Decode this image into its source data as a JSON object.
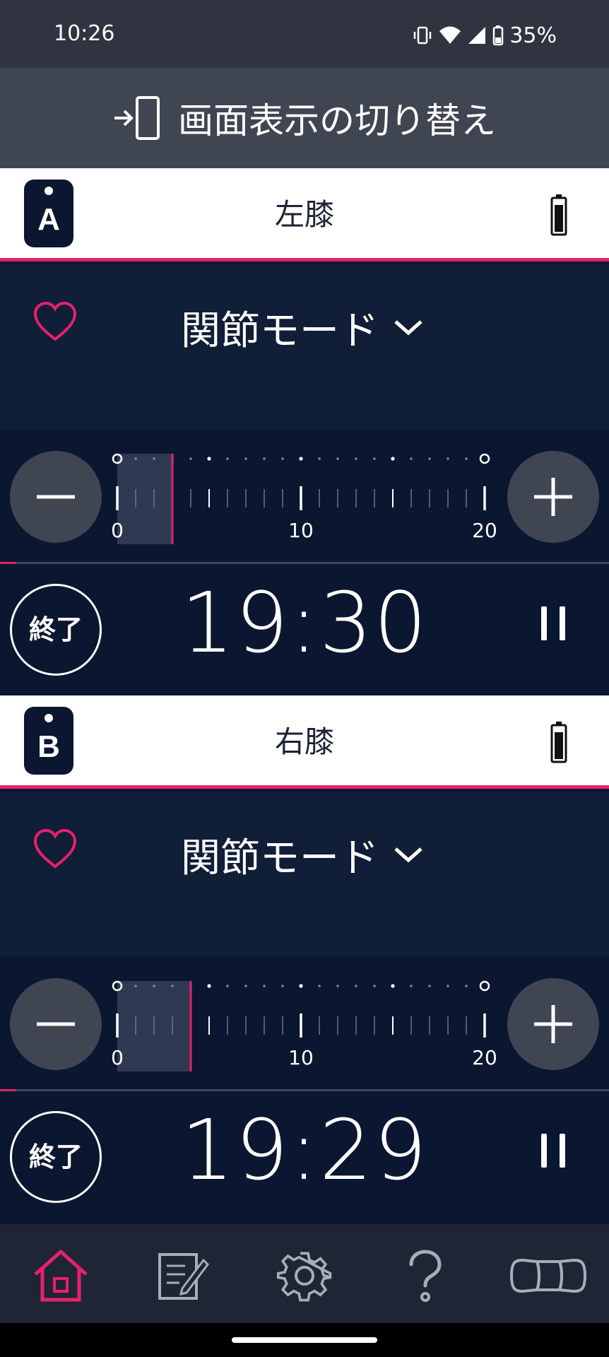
{
  "status_bar": {
    "time": "10:26",
    "battery": "35%"
  },
  "switch_bar": {
    "label": "画面表示の切り替え",
    "icon": "switch-screen-icon"
  },
  "devices": [
    {
      "badge": "A",
      "name": "左膝",
      "mode": "関節モード",
      "scale": {
        "min_label": "0",
        "mid_label": "10",
        "max_label": "20",
        "level": 3
      },
      "progress": 0.025,
      "end_label": "終了",
      "timer": "19:30"
    },
    {
      "badge": "B",
      "name": "右膝",
      "mode": "関節モード",
      "scale": {
        "min_label": "0",
        "mid_label": "10",
        "max_label": "20",
        "level": 4
      },
      "progress": 0.025,
      "end_label": "終了",
      "timer": "19:29"
    }
  ],
  "colors": {
    "accent": "#e8206b",
    "background": "#0b1731",
    "panel": "#111e38",
    "button": "#404552"
  },
  "nav": [
    {
      "icon": "home-icon",
      "active": true
    },
    {
      "icon": "notes-icon",
      "active": false
    },
    {
      "icon": "settings-icon",
      "active": false
    },
    {
      "icon": "help-icon",
      "active": false
    },
    {
      "icon": "device-pads-icon",
      "active": false
    }
  ]
}
